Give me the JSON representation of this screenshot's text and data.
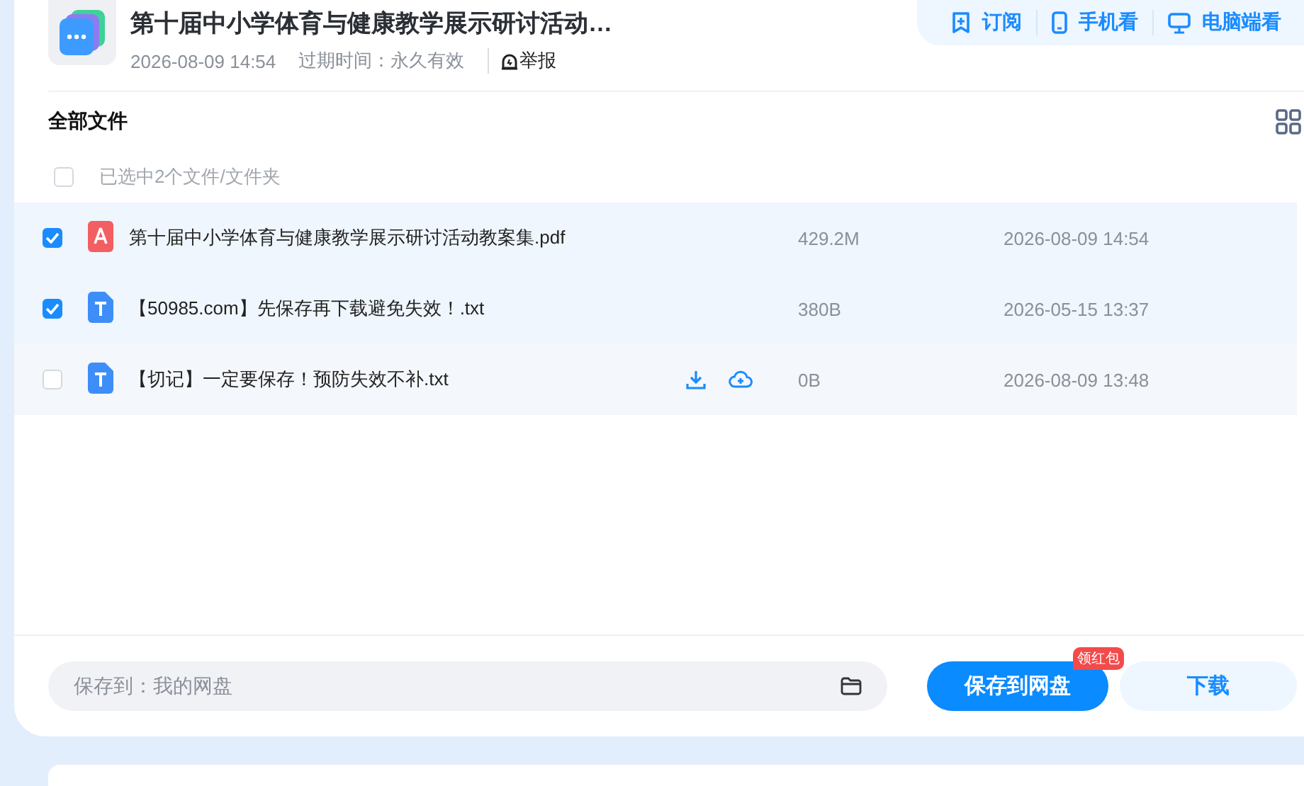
{
  "header": {
    "title": "第十届中小学体育与健康教学展示研讨活动…",
    "date": "2026-08-09 14:54",
    "expiry": "过期时间：永久有效",
    "report": "举报",
    "actions": [
      {
        "label": "订阅"
      },
      {
        "label": "手机看"
      },
      {
        "label": "电脑端看"
      }
    ]
  },
  "files": {
    "title": "全部文件",
    "select_all": {
      "label": "已选中2个文件/文件夹",
      "checked": false
    },
    "rows": [
      {
        "kind": "pdf",
        "name": "第十届中小学体育与健康教学展示研讨活动教案集.pdf",
        "size": "429.2M",
        "date": "2026-08-09 14:54",
        "checked": true,
        "hovered": false
      },
      {
        "kind": "txt",
        "name": "【50985.com】先保存再下载避免失效！.txt",
        "size": "380B",
        "date": "2026-05-15 13:37",
        "checked": true,
        "hovered": false
      },
      {
        "kind": "txt",
        "name": "【切记】一定要保存！预防失效不补.txt",
        "size": "0B",
        "date": "2026-08-09 13:48",
        "checked": false,
        "hovered": true
      }
    ]
  },
  "save_bar": {
    "location": "保存到：我的网盘",
    "save_button": "保存到网盘",
    "badge": "领红包",
    "download_button": "下载"
  }
}
